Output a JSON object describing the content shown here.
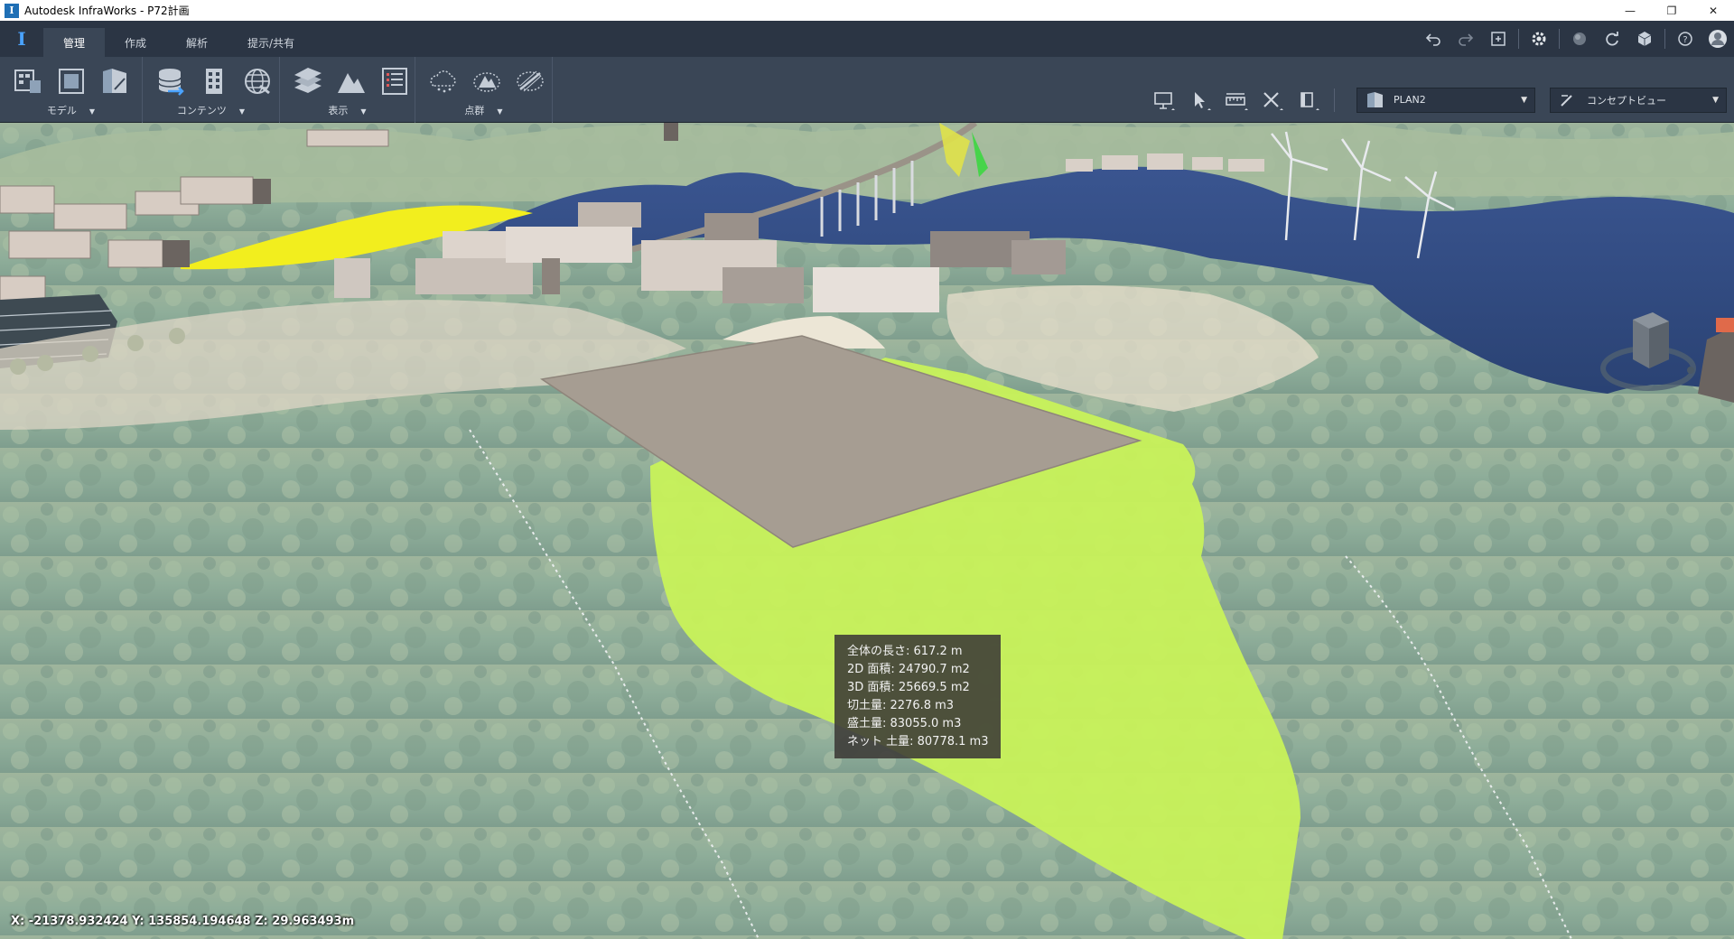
{
  "window": {
    "app_icon_letter": "I",
    "title": "Autodesk InfraWorks - P72計画",
    "minimize": "—",
    "restore": "❐",
    "close": "✕"
  },
  "topbar": {
    "logo": "I",
    "tabs": [
      {
        "label": "管理",
        "active": true
      },
      {
        "label": "作成",
        "active": false
      },
      {
        "label": "解析",
        "active": false
      },
      {
        "label": "提示/共有",
        "active": false
      }
    ],
    "icons": [
      "undo-icon",
      "redo-icon",
      "fullscreen-icon",
      "settings-icon",
      "sphere-icon",
      "sync-icon",
      "cube-icon",
      "help-icon",
      "user-avatar-icon"
    ]
  },
  "ribbon": {
    "panels": [
      {
        "label": "モデル"
      },
      {
        "label": "コンテンツ"
      },
      {
        "label": "表示"
      },
      {
        "label": "点群"
      }
    ],
    "proposal_dropdown": "PLAN2",
    "view_dropdown": "コンセプトビュー"
  },
  "measurement": {
    "total_length": "全体の長さ: 617.2 m",
    "area_2d": "2D 面積: 24790.7 m2",
    "area_3d": "3D 面積: 25669.5 m2",
    "cut": "切土量: 2276.8 m3",
    "fill": "盛土量: 83055.0 m3",
    "net": "ネット 土量: 80778.1 m3"
  },
  "status": {
    "coordinates": "X: -21378.932424 Y: 135854.194648 Z: 29.963493m"
  },
  "colors": {
    "chrome_dark": "#2b3544",
    "ribbon": "#3a4656",
    "grading_fill": "#c8f25a",
    "highlight_yellow": "#f2ee1e",
    "water": "#2f4a7e",
    "terrain": "#8fae98"
  }
}
